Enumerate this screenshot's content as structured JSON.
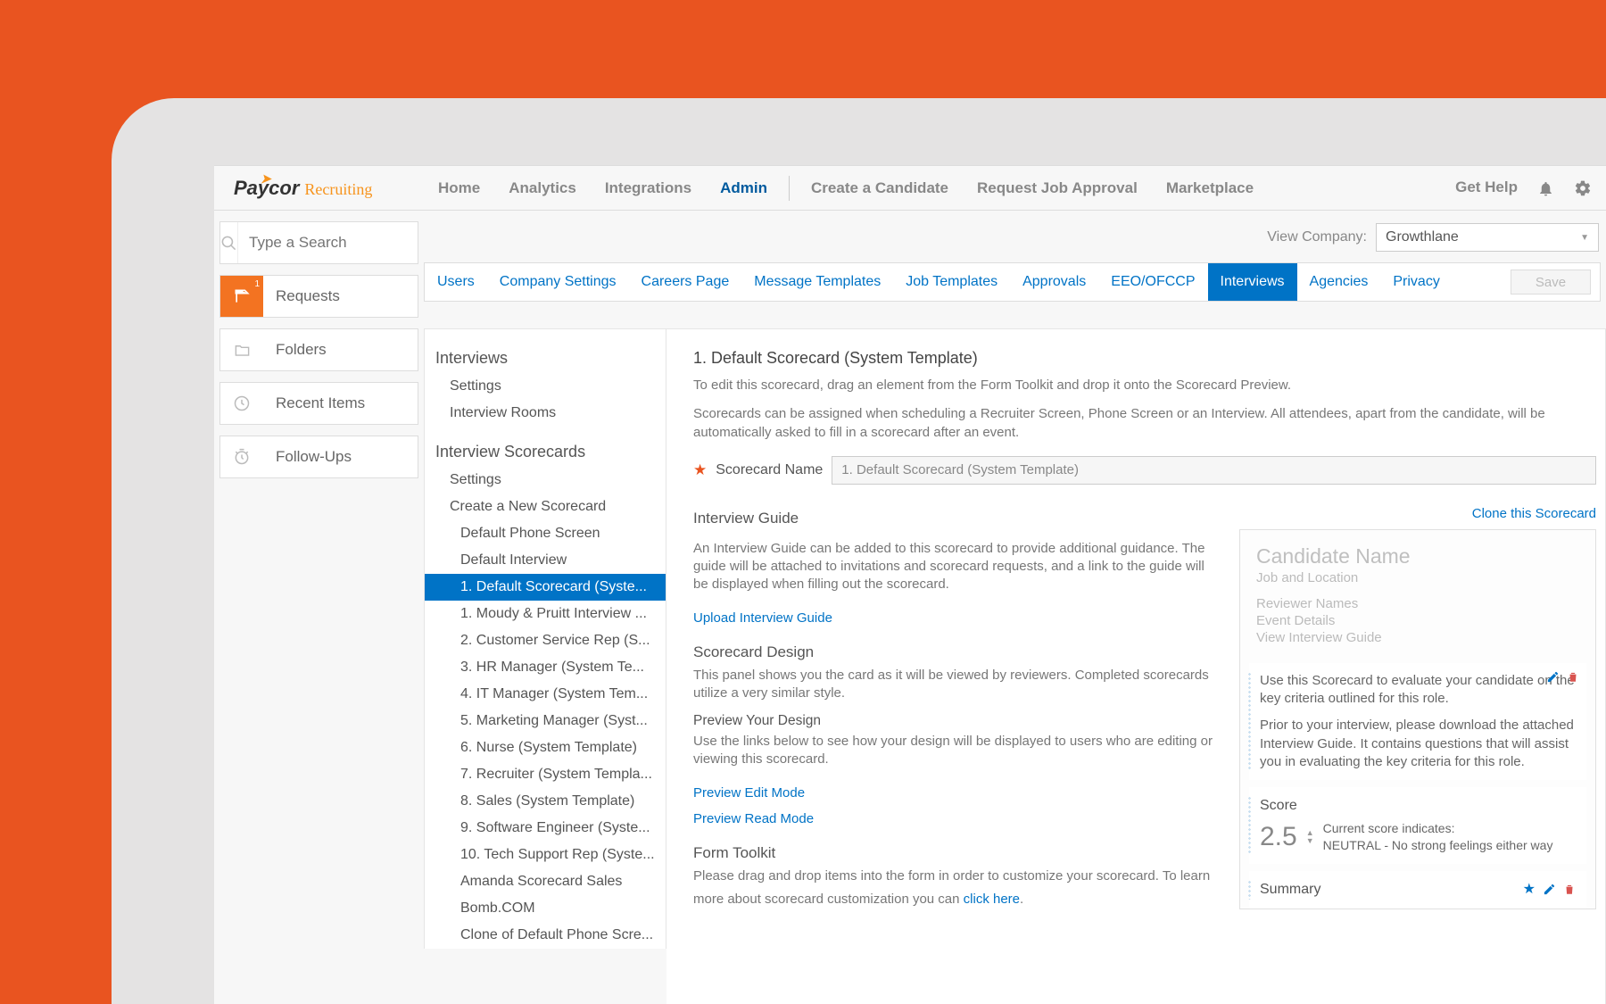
{
  "brand": {
    "main": "Paycor",
    "sub": "Recruiting"
  },
  "topnav": {
    "items": [
      "Home",
      "Analytics",
      "Integrations",
      "Admin",
      "Create a Candidate",
      "Request Job Approval",
      "Marketplace"
    ],
    "active_index": 3,
    "divider_after_index": 3,
    "help": "Get Help"
  },
  "search": {
    "placeholder": "Type a Search"
  },
  "leftnav": {
    "items": [
      {
        "label": "Requests",
        "badge": "1",
        "active": true
      },
      {
        "label": "Folders"
      },
      {
        "label": "Recent Items"
      },
      {
        "label": "Follow-Ups"
      }
    ]
  },
  "company": {
    "label": "View Company:",
    "value": "Growthlane"
  },
  "admin_tabs": {
    "items": [
      "Users",
      "Company Settings",
      "Careers Page",
      "Message Templates",
      "Job Templates",
      "Approvals",
      "EEO/OFCCP",
      "Interviews",
      "Agencies",
      "Privacy"
    ],
    "active_index": 7,
    "save": "Save"
  },
  "tree": {
    "section1_title": "Interviews",
    "section1_items": [
      "Settings",
      "Interview Rooms"
    ],
    "section2_title": "Interview Scorecards",
    "section2_items": [
      "Settings",
      "Create a New Scorecard"
    ],
    "section2_sub": [
      "Default Phone Screen",
      "Default Interview",
      "1. Default Scorecard (Syste...",
      "1. Moudy & Pruitt Interview ...",
      "2. Customer Service Rep (S...",
      "3. HR Manager (System Te...",
      "4. IT Manager (System Tem...",
      "5. Marketing Manager (Syst...",
      "6. Nurse (System Template)",
      "7. Recruiter (System Templa...",
      "8. Sales (System Template)",
      "9. Software Engineer (Syste...",
      "10. Tech Support Rep (Syste...",
      "Amanda Scorecard Sales",
      "Bomb.COM",
      "Clone of Default Phone Scre..."
    ],
    "selected_sub_index": 2
  },
  "detail": {
    "title": "1. Default Scorecard (System Template)",
    "p1": "To edit this scorecard, drag an element from the Form Toolkit and drop it onto the Scorecard Preview.",
    "p2": "Scorecards can be assigned when scheduling a Recruiter Screen, Phone Screen or an Interview. All attendees, apart from the candidate, will be automatically asked to fill in a scorecard after an event.",
    "name_label": "Scorecard Name",
    "name_value": "1. Default Scorecard (System Template)",
    "guide_heading": "Interview Guide",
    "guide_p": "An Interview Guide can be added to this scorecard to provide additional guidance. The guide will be attached to invitations and scorecard requests, and a link to the guide will be displayed when filling out the scorecard.",
    "guide_link": "Upload Interview Guide",
    "clone_link": "Clone this Scorecard",
    "design_heading": "Scorecard Design",
    "design_p": "This panel shows you the card as it will be viewed by reviewers. Completed scorecards utilize a very similar style.",
    "preview_heading": "Preview Your Design",
    "preview_p": "Use the links below to see how your design will be displayed to users who are editing or viewing this scorecard.",
    "preview_edit_link": "Preview Edit Mode",
    "preview_read_link": "Preview Read Mode",
    "toolkit_heading": "Form Toolkit",
    "toolkit_p_a": "Please drag and drop items into the form in order to customize your scorecard. To learn more about scorecard customization you can ",
    "toolkit_p_link": "click here"
  },
  "preview": {
    "name": "Candidate Name",
    "loc": "Job and Location",
    "reviewers": "Reviewer Names",
    "event": "Event Details",
    "viewguide": "View Interview Guide",
    "intro1": "Use this Scorecard to evaluate your candidate on the key criteria outlined for this role.",
    "intro2": "Prior to your interview, please download the attached Interview Guide. It contains questions that will assist you in evaluating the key criteria for this role.",
    "score_label": "Score",
    "score_value": "2.5",
    "score_text_a": "Current score indicates:",
    "score_text_b": "NEUTRAL - No strong feelings either way",
    "summary_label": "Summary"
  }
}
